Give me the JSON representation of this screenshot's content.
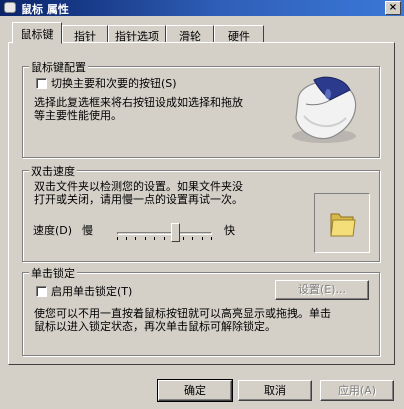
{
  "window": {
    "title": "鼠标 属性",
    "close_glyph": "×"
  },
  "tabs": [
    {
      "label": "鼠标键",
      "active": true
    },
    {
      "label": "指针",
      "active": false
    },
    {
      "label": "指针选项",
      "active": false
    },
    {
      "label": "滑轮",
      "active": false
    },
    {
      "label": "硬件",
      "active": false
    }
  ],
  "button_config": {
    "group_label": "鼠标键配置",
    "swap_checkbox_label": "切换主要和次要的按钮(S)",
    "swap_checked": false,
    "description_line1": "选择此复选框来将右按钮设成如选择和拖放",
    "description_line2": "等主要性能使用。",
    "illustration": "mouse-icon"
  },
  "double_click": {
    "group_label": "双击速度",
    "description_line1": "双击文件夹以检测您的设置。如果文件夹没",
    "description_line2": "打开或关闭，请用慢一点的设置再试一次。",
    "speed_label": "速度(D)",
    "slow_label": "慢",
    "fast_label": "快",
    "speed_level": 0.6,
    "test_folder_icon": "folder-icon"
  },
  "click_lock": {
    "group_label": "单击锁定",
    "enable_checkbox_label": "启用单击锁定(T)",
    "enabled": false,
    "settings_button": "设置(E)...",
    "description_line1": "使您可以不用一直按着鼠标按钮就可以高亮显示或拖拽。单击",
    "description_line2": "鼠标以进入锁定状态，再次单击鼠标可解除锁定。"
  },
  "footer": {
    "ok": "确定",
    "cancel": "取消",
    "apply": "应用(A)"
  }
}
